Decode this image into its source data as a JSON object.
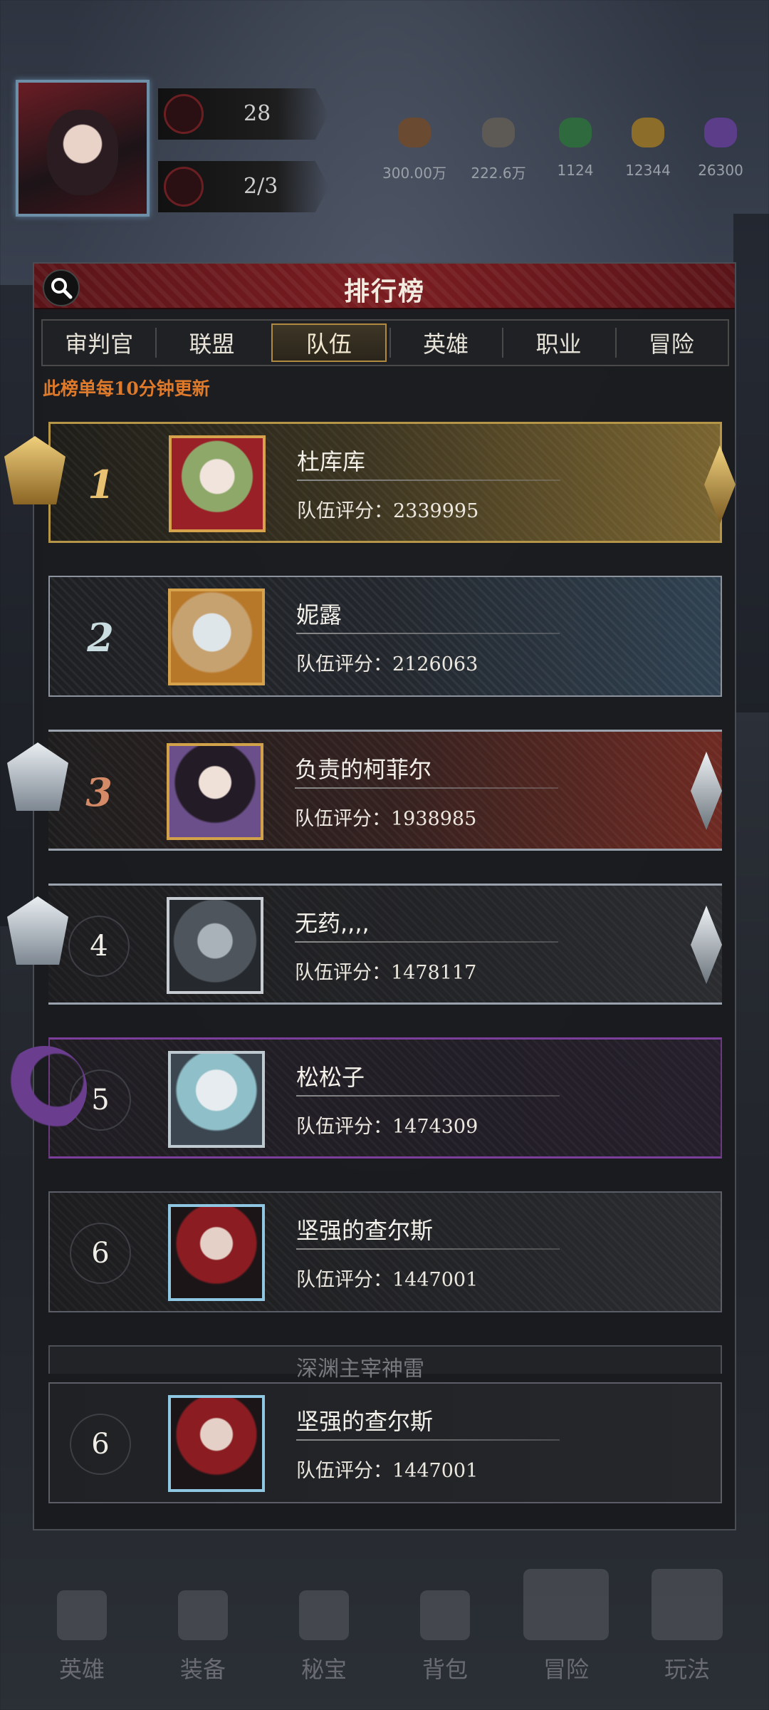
{
  "hud": {
    "level_value": "28",
    "energy_value": "2/3",
    "resources": [
      {
        "icon": "leather-icon",
        "value": "300.00万",
        "color": "#6b4a32"
      },
      {
        "icon": "ore-icon",
        "value": "222.6万",
        "color": "#5d5a55"
      },
      {
        "icon": "green-gem-icon",
        "value": "1124",
        "color": "#2f6a3f"
      },
      {
        "icon": "gold-seed-icon",
        "value": "12344",
        "color": "#8c6d2a"
      },
      {
        "icon": "purple-crystal-icon",
        "value": "26300",
        "color": "#5b3d8a"
      }
    ]
  },
  "panel": {
    "title": "排行榜",
    "notice": "此榜单每10分钟更新",
    "tabs": [
      {
        "label": "审判官",
        "active": false
      },
      {
        "label": "联盟",
        "active": false
      },
      {
        "label": "队伍",
        "active": true
      },
      {
        "label": "英雄",
        "active": false
      },
      {
        "label": "职业",
        "active": false
      },
      {
        "label": "冒险",
        "active": false
      }
    ],
    "rows": [
      {
        "rank": "1",
        "name": "杜库库",
        "score": "队伍评分：2339995"
      },
      {
        "rank": "2",
        "name": "妮露",
        "score": "队伍评分：2126063"
      },
      {
        "rank": "3",
        "name": "负责的柯菲尔",
        "score": "队伍评分：1938985"
      },
      {
        "rank": "4",
        "name": "无药,,,,",
        "score": "队伍评分：1478117"
      },
      {
        "rank": "5",
        "name": "松松子",
        "score": "队伍评分：1474309"
      },
      {
        "rank": "6",
        "name": "坚强的查尔斯",
        "score": "队伍评分：1447001"
      }
    ],
    "peek_row_name": "深渊主宰神雷",
    "my_row": {
      "rank": "6",
      "name": "坚强的查尔斯",
      "score": "队伍评分：1447001"
    }
  },
  "nav": {
    "items": [
      {
        "label": "英雄",
        "icon": "hero-icon"
      },
      {
        "label": "装备",
        "icon": "equipment-icon"
      },
      {
        "label": "秘宝",
        "icon": "treasure-icon"
      },
      {
        "label": "背包",
        "icon": "bag-icon"
      },
      {
        "label": "冒险",
        "icon": "adventure-icon"
      },
      {
        "label": "玩法",
        "icon": "gameplay-icon"
      }
    ]
  }
}
